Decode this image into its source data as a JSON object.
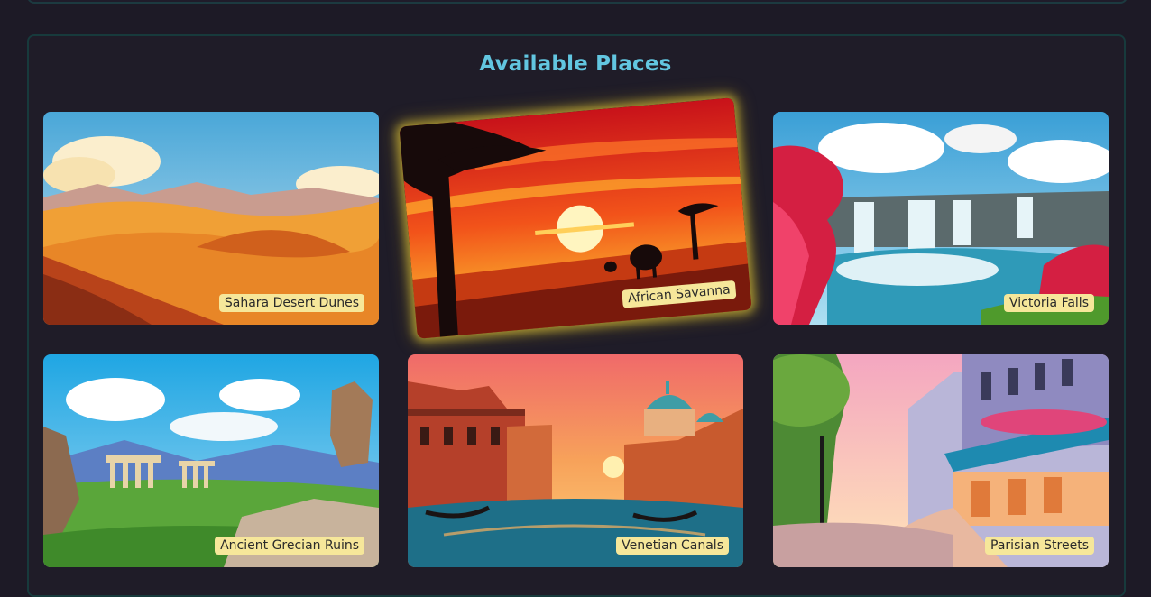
{
  "section": {
    "title": "Available Places"
  },
  "places": [
    {
      "label": "Sahara Desert Dunes",
      "selected": false
    },
    {
      "label": "African Savanna",
      "selected": true
    },
    {
      "label": "Victoria Falls",
      "selected": false
    },
    {
      "label": "Ancient Grecian Ruins",
      "selected": false
    },
    {
      "label": "Venetian Canals",
      "selected": false
    },
    {
      "label": "Parisian Streets",
      "selected": false
    }
  ],
  "colors": {
    "background": "#1d1a26",
    "title": "#62c6e0",
    "label_bg": "#f6e79a",
    "selected_glow": "#ebd23c",
    "panel_border": "#173a3c"
  }
}
